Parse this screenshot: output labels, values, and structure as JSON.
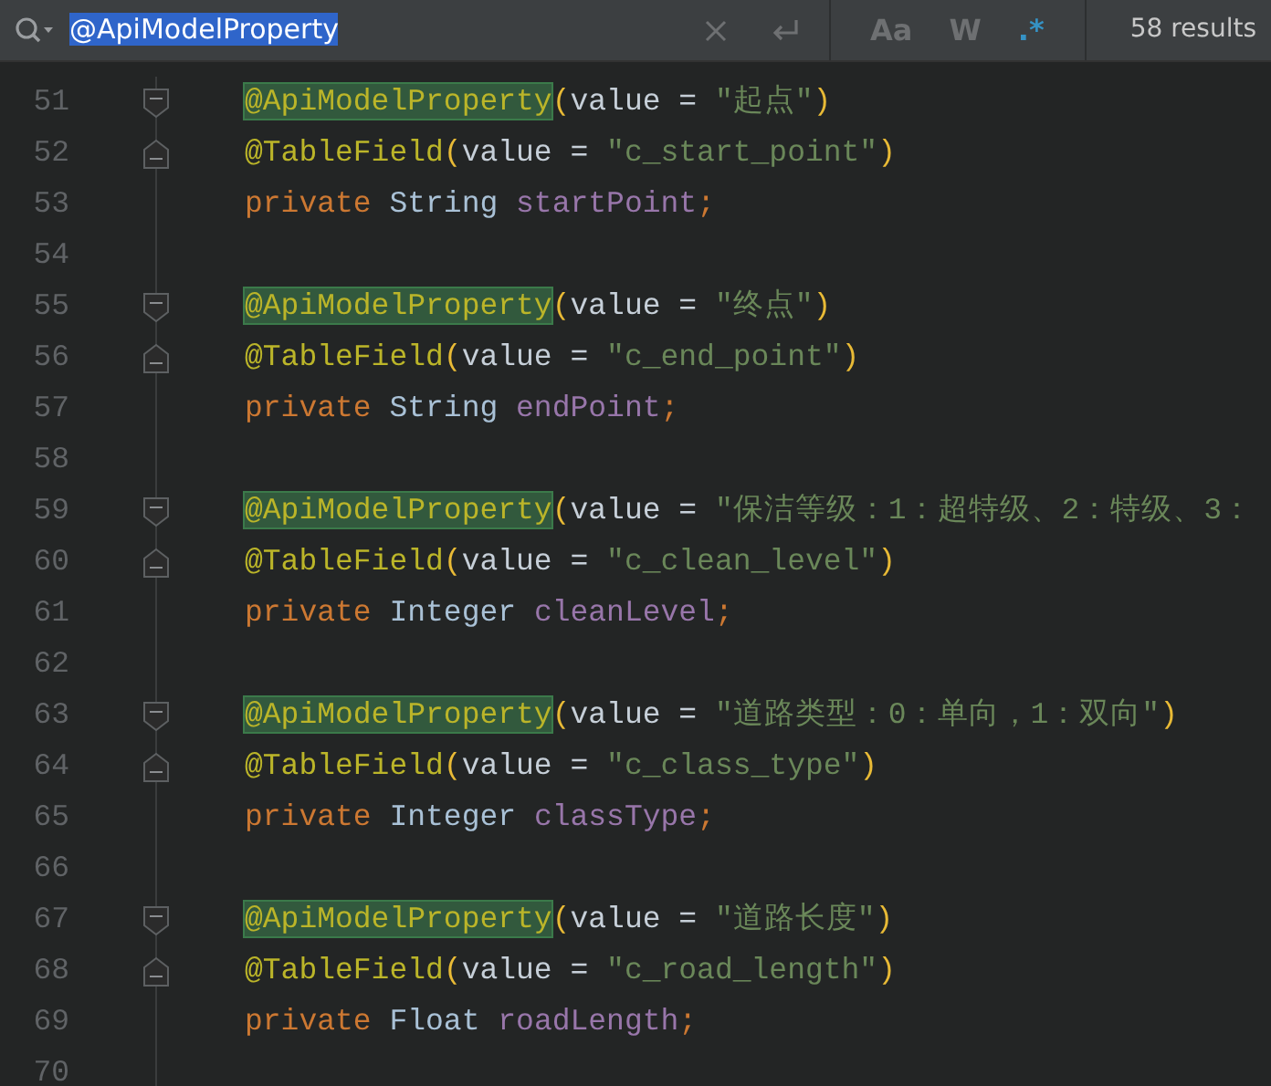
{
  "search": {
    "query": "@ApiModelProperty",
    "query_selected": true,
    "toggles": [
      {
        "label": "Aa",
        "on": false
      },
      {
        "label": "W",
        "on": false
      },
      {
        "label": ".*",
        "on": true
      }
    ],
    "results": "58 results"
  },
  "lines": [
    {
      "number": "51",
      "fold_start": true,
      "fold_end": false,
      "tokens": [
        {
          "kind": "annotation",
          "text": "@ApiModelProperty",
          "match": true
        },
        {
          "kind": "bracket",
          "text": "("
        },
        {
          "kind": "plain",
          "text": "value = "
        },
        {
          "kind": "string",
          "text": "\"起点\""
        },
        {
          "kind": "bracket",
          "text": ")"
        }
      ]
    },
    {
      "number": "52",
      "fold_start": false,
      "fold_end": true,
      "tokens": [
        {
          "kind": "annotation",
          "text": "@TableField",
          "match": false
        },
        {
          "kind": "bracket",
          "text": "("
        },
        {
          "kind": "plain",
          "text": "value = "
        },
        {
          "kind": "string",
          "text": "\"c_start_point\""
        },
        {
          "kind": "bracket",
          "text": ")"
        }
      ]
    },
    {
      "number": "53",
      "fold_start": false,
      "fold_end": false,
      "tokens": [
        {
          "kind": "keyword",
          "text": "private "
        },
        {
          "kind": "type",
          "text": "String "
        },
        {
          "kind": "field",
          "text": "startPoint"
        },
        {
          "kind": "keyword",
          "text": ";"
        }
      ]
    },
    {
      "number": "54",
      "fold_start": false,
      "fold_end": false
    },
    {
      "number": "55",
      "fold_start": true,
      "fold_end": false,
      "tokens": [
        {
          "kind": "annotation",
          "text": "@ApiModelProperty",
          "match": true
        },
        {
          "kind": "bracket",
          "text": "("
        },
        {
          "kind": "plain",
          "text": "value = "
        },
        {
          "kind": "string",
          "text": "\"终点\""
        },
        {
          "kind": "bracket",
          "text": ")"
        }
      ]
    },
    {
      "number": "56",
      "fold_start": false,
      "fold_end": true,
      "tokens": [
        {
          "kind": "annotation",
          "text": "@TableField",
          "match": false
        },
        {
          "kind": "bracket",
          "text": "("
        },
        {
          "kind": "plain",
          "text": "value = "
        },
        {
          "kind": "string",
          "text": "\"c_end_point\""
        },
        {
          "kind": "bracket",
          "text": ")"
        }
      ]
    },
    {
      "number": "57",
      "fold_start": false,
      "fold_end": false,
      "tokens": [
        {
          "kind": "keyword",
          "text": "private "
        },
        {
          "kind": "type",
          "text": "String "
        },
        {
          "kind": "field",
          "text": "endPoint"
        },
        {
          "kind": "keyword",
          "text": ";"
        }
      ]
    },
    {
      "number": "58",
      "fold_start": false,
      "fold_end": false
    },
    {
      "number": "59",
      "fold_start": true,
      "fold_end": false,
      "tokens": [
        {
          "kind": "annotation",
          "text": "@ApiModelProperty",
          "match": true
        },
        {
          "kind": "bracket",
          "text": "("
        },
        {
          "kind": "plain",
          "text": "value = "
        },
        {
          "kind": "string",
          "text": "\"保洁等级：1：超特级、2：特级、3："
        }
      ]
    },
    {
      "number": "60",
      "fold_start": false,
      "fold_end": true,
      "tokens": [
        {
          "kind": "annotation",
          "text": "@TableField",
          "match": false
        },
        {
          "kind": "bracket",
          "text": "("
        },
        {
          "kind": "plain",
          "text": "value = "
        },
        {
          "kind": "string",
          "text": "\"c_clean_level\""
        },
        {
          "kind": "bracket",
          "text": ")"
        }
      ]
    },
    {
      "number": "61",
      "fold_start": false,
      "fold_end": false,
      "tokens": [
        {
          "kind": "keyword",
          "text": "private "
        },
        {
          "kind": "type",
          "text": "Integer "
        },
        {
          "kind": "field",
          "text": "cleanLevel"
        },
        {
          "kind": "keyword",
          "text": ";"
        }
      ]
    },
    {
      "number": "62",
      "fold_start": false,
      "fold_end": false
    },
    {
      "number": "63",
      "fold_start": true,
      "fold_end": false,
      "tokens": [
        {
          "kind": "annotation",
          "text": "@ApiModelProperty",
          "match": true
        },
        {
          "kind": "bracket",
          "text": "("
        },
        {
          "kind": "plain",
          "text": "value = "
        },
        {
          "kind": "string",
          "text": "\"道路类型：0：单向，1：双向\""
        },
        {
          "kind": "bracket",
          "text": ")"
        }
      ]
    },
    {
      "number": "64",
      "fold_start": false,
      "fold_end": true,
      "tokens": [
        {
          "kind": "annotation",
          "text": "@TableField",
          "match": false
        },
        {
          "kind": "bracket",
          "text": "("
        },
        {
          "kind": "plain",
          "text": "value = "
        },
        {
          "kind": "string",
          "text": "\"c_class_type\""
        },
        {
          "kind": "bracket",
          "text": ")"
        }
      ]
    },
    {
      "number": "65",
      "fold_start": false,
      "fold_end": false,
      "tokens": [
        {
          "kind": "keyword",
          "text": "private "
        },
        {
          "kind": "type",
          "text": "Integer "
        },
        {
          "kind": "field",
          "text": "classType"
        },
        {
          "kind": "keyword",
          "text": ";"
        }
      ]
    },
    {
      "number": "66",
      "fold_start": false,
      "fold_end": false
    },
    {
      "number": "67",
      "fold_start": true,
      "fold_end": false,
      "tokens": [
        {
          "kind": "annotation",
          "text": "@ApiModelProperty",
          "match": true
        },
        {
          "kind": "bracket",
          "text": "("
        },
        {
          "kind": "plain",
          "text": "value = "
        },
        {
          "kind": "string",
          "text": "\"道路长度\""
        },
        {
          "kind": "bracket",
          "text": ")"
        }
      ]
    },
    {
      "number": "68",
      "fold_start": false,
      "fold_end": true,
      "tokens": [
        {
          "kind": "annotation",
          "text": "@TableField",
          "match": false
        },
        {
          "kind": "bracket",
          "text": "("
        },
        {
          "kind": "plain",
          "text": "value = "
        },
        {
          "kind": "string",
          "text": "\"c_road_length\""
        },
        {
          "kind": "bracket",
          "text": ")"
        }
      ]
    },
    {
      "number": "69",
      "fold_start": false,
      "fold_end": false,
      "tokens": [
        {
          "kind": "keyword",
          "text": "private "
        },
        {
          "kind": "type",
          "text": "Float "
        },
        {
          "kind": "field",
          "text": "roadLength"
        },
        {
          "kind": "keyword",
          "text": ";"
        }
      ]
    },
    {
      "number": "70",
      "fold_start": false,
      "fold_end": false
    }
  ]
}
